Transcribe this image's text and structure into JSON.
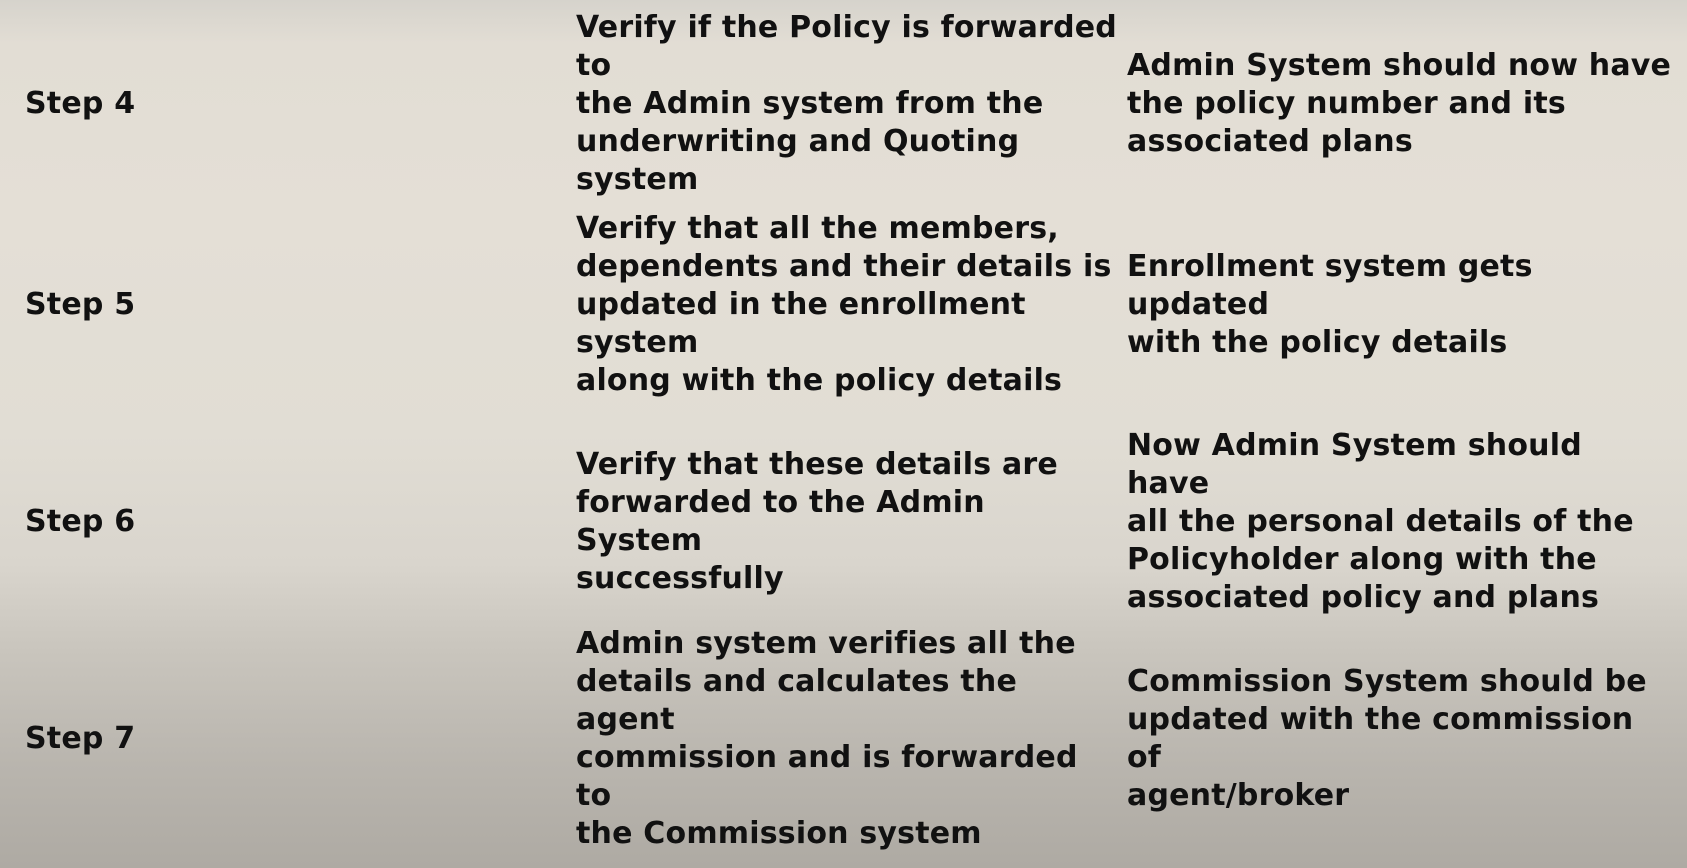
{
  "rows": [
    {
      "step": "Step 4",
      "action": "Verify if the Policy is forwarded to\nthe Admin system from the\nunderwriting and Quoting system",
      "expected": "Admin System should now have\nthe policy number and its\nassociated plans"
    },
    {
      "step": "Step 5",
      "action": "Verify that all the members,\ndependents and their details is\nupdated in the enrollment system\nalong with the policy details",
      "expected": "Enrollment system gets updated\nwith the policy details"
    },
    {
      "step": "Step 6",
      "action": "Verify that these details are\nforwarded to the Admin System\nsuccessfully",
      "expected": "Now Admin System should have\nall the personal details of the\nPolicyholder along with the\nassociated policy and plans"
    },
    {
      "step": "Step 7",
      "action": "Admin system verifies all the\ndetails and calculates the agent\ncommission and is forwarded to\nthe Commission system",
      "expected": "Commission System should be\nupdated with the commission of\nagent/broker"
    }
  ]
}
